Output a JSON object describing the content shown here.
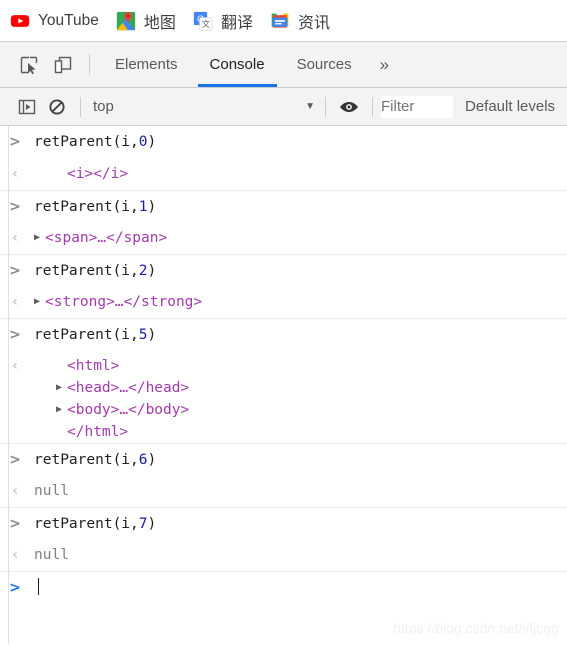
{
  "bookmarks_bar": {
    "items": [
      {
        "label": "YouTube",
        "icon": "youtube-icon"
      },
      {
        "label": "地图",
        "icon": "google-maps-icon"
      },
      {
        "label": "翻译",
        "icon": "google-translate-icon"
      },
      {
        "label": "资讯",
        "icon": "google-news-icon"
      }
    ]
  },
  "devtools": {
    "toolbar_buttons": [
      {
        "name": "inspect-element-icon",
        "title": "Inspect element"
      },
      {
        "name": "device-toolbar-icon",
        "title": "Toggle device toolbar"
      }
    ],
    "tabs": [
      {
        "label": "Elements",
        "active": false
      },
      {
        "label": "Console",
        "active": true
      },
      {
        "label": "Sources",
        "active": false
      }
    ],
    "more_tabs_label": "»",
    "console_toolbar": {
      "sidebar_toggle_icon": "console-sidebar-icon",
      "clear_console_icon": "clear-console-icon",
      "context_selector_value": "top",
      "context_caret": "▼",
      "eye_icon": "live-expression-eye-icon",
      "filter_placeholder": "Filter",
      "levels_label": "Default levels"
    }
  },
  "console": {
    "entries": [
      {
        "type": "input",
        "marker": ">",
        "command_prefix": "retParent(i,",
        "command_arg": "0",
        "command_suffix": ")"
      },
      {
        "type": "output",
        "marker": "‹",
        "node_lines": [
          {
            "triangle": "",
            "indent": 1,
            "text": "<i></i>",
            "kind": "tag"
          }
        ]
      },
      {
        "type": "input",
        "marker": ">",
        "command_prefix": "retParent(i,",
        "command_arg": "1",
        "command_suffix": ")"
      },
      {
        "type": "output",
        "marker": "‹",
        "node_lines": [
          {
            "triangle": "▶",
            "indent": 0,
            "text": "<span>…</span>",
            "kind": "tag"
          }
        ]
      },
      {
        "type": "input",
        "marker": ">",
        "command_prefix": "retParent(i,",
        "command_arg": "2",
        "command_suffix": ")"
      },
      {
        "type": "output",
        "marker": "‹",
        "node_lines": [
          {
            "triangle": "▶",
            "indent": 0,
            "text": "<strong>…</strong>",
            "kind": "tag"
          }
        ]
      },
      {
        "type": "input",
        "marker": ">",
        "command_prefix": "retParent(i,",
        "command_arg": "5",
        "command_suffix": ")"
      },
      {
        "type": "output",
        "marker": "‹",
        "node_lines": [
          {
            "triangle": "",
            "indent": 1,
            "text": "<html>",
            "kind": "tag"
          },
          {
            "triangle": "▶",
            "indent": 1,
            "text": "<head>…</head>",
            "kind": "tag"
          },
          {
            "triangle": "▶",
            "indent": 1,
            "text": "<body>…</body>",
            "kind": "tag"
          },
          {
            "triangle": "",
            "indent": 1,
            "text": "</html>",
            "kind": "tag"
          }
        ]
      },
      {
        "type": "input",
        "marker": ">",
        "command_prefix": "retParent(i,",
        "command_arg": "6",
        "command_suffix": ")"
      },
      {
        "type": "output",
        "marker": "‹",
        "node_lines": [
          {
            "triangle": "",
            "indent": 0,
            "text": "null",
            "kind": "null"
          }
        ]
      },
      {
        "type": "input",
        "marker": ">",
        "command_prefix": "retParent(i,",
        "command_arg": "7",
        "command_suffix": ")"
      },
      {
        "type": "output",
        "marker": "‹",
        "node_lines": [
          {
            "triangle": "",
            "indent": 0,
            "text": "null",
            "kind": "null"
          }
        ]
      },
      {
        "type": "prompt",
        "marker": ">",
        "value": ""
      }
    ],
    "watermark": "https://blog.csdn.net/vfjcgg"
  },
  "colors": {
    "accent": "#1a73e8",
    "tag": "#a23bab",
    "number": "#1a1aa6",
    "null": "#808080",
    "toolbar_bg": "#f3f3f3",
    "border": "#cdcdcd"
  }
}
